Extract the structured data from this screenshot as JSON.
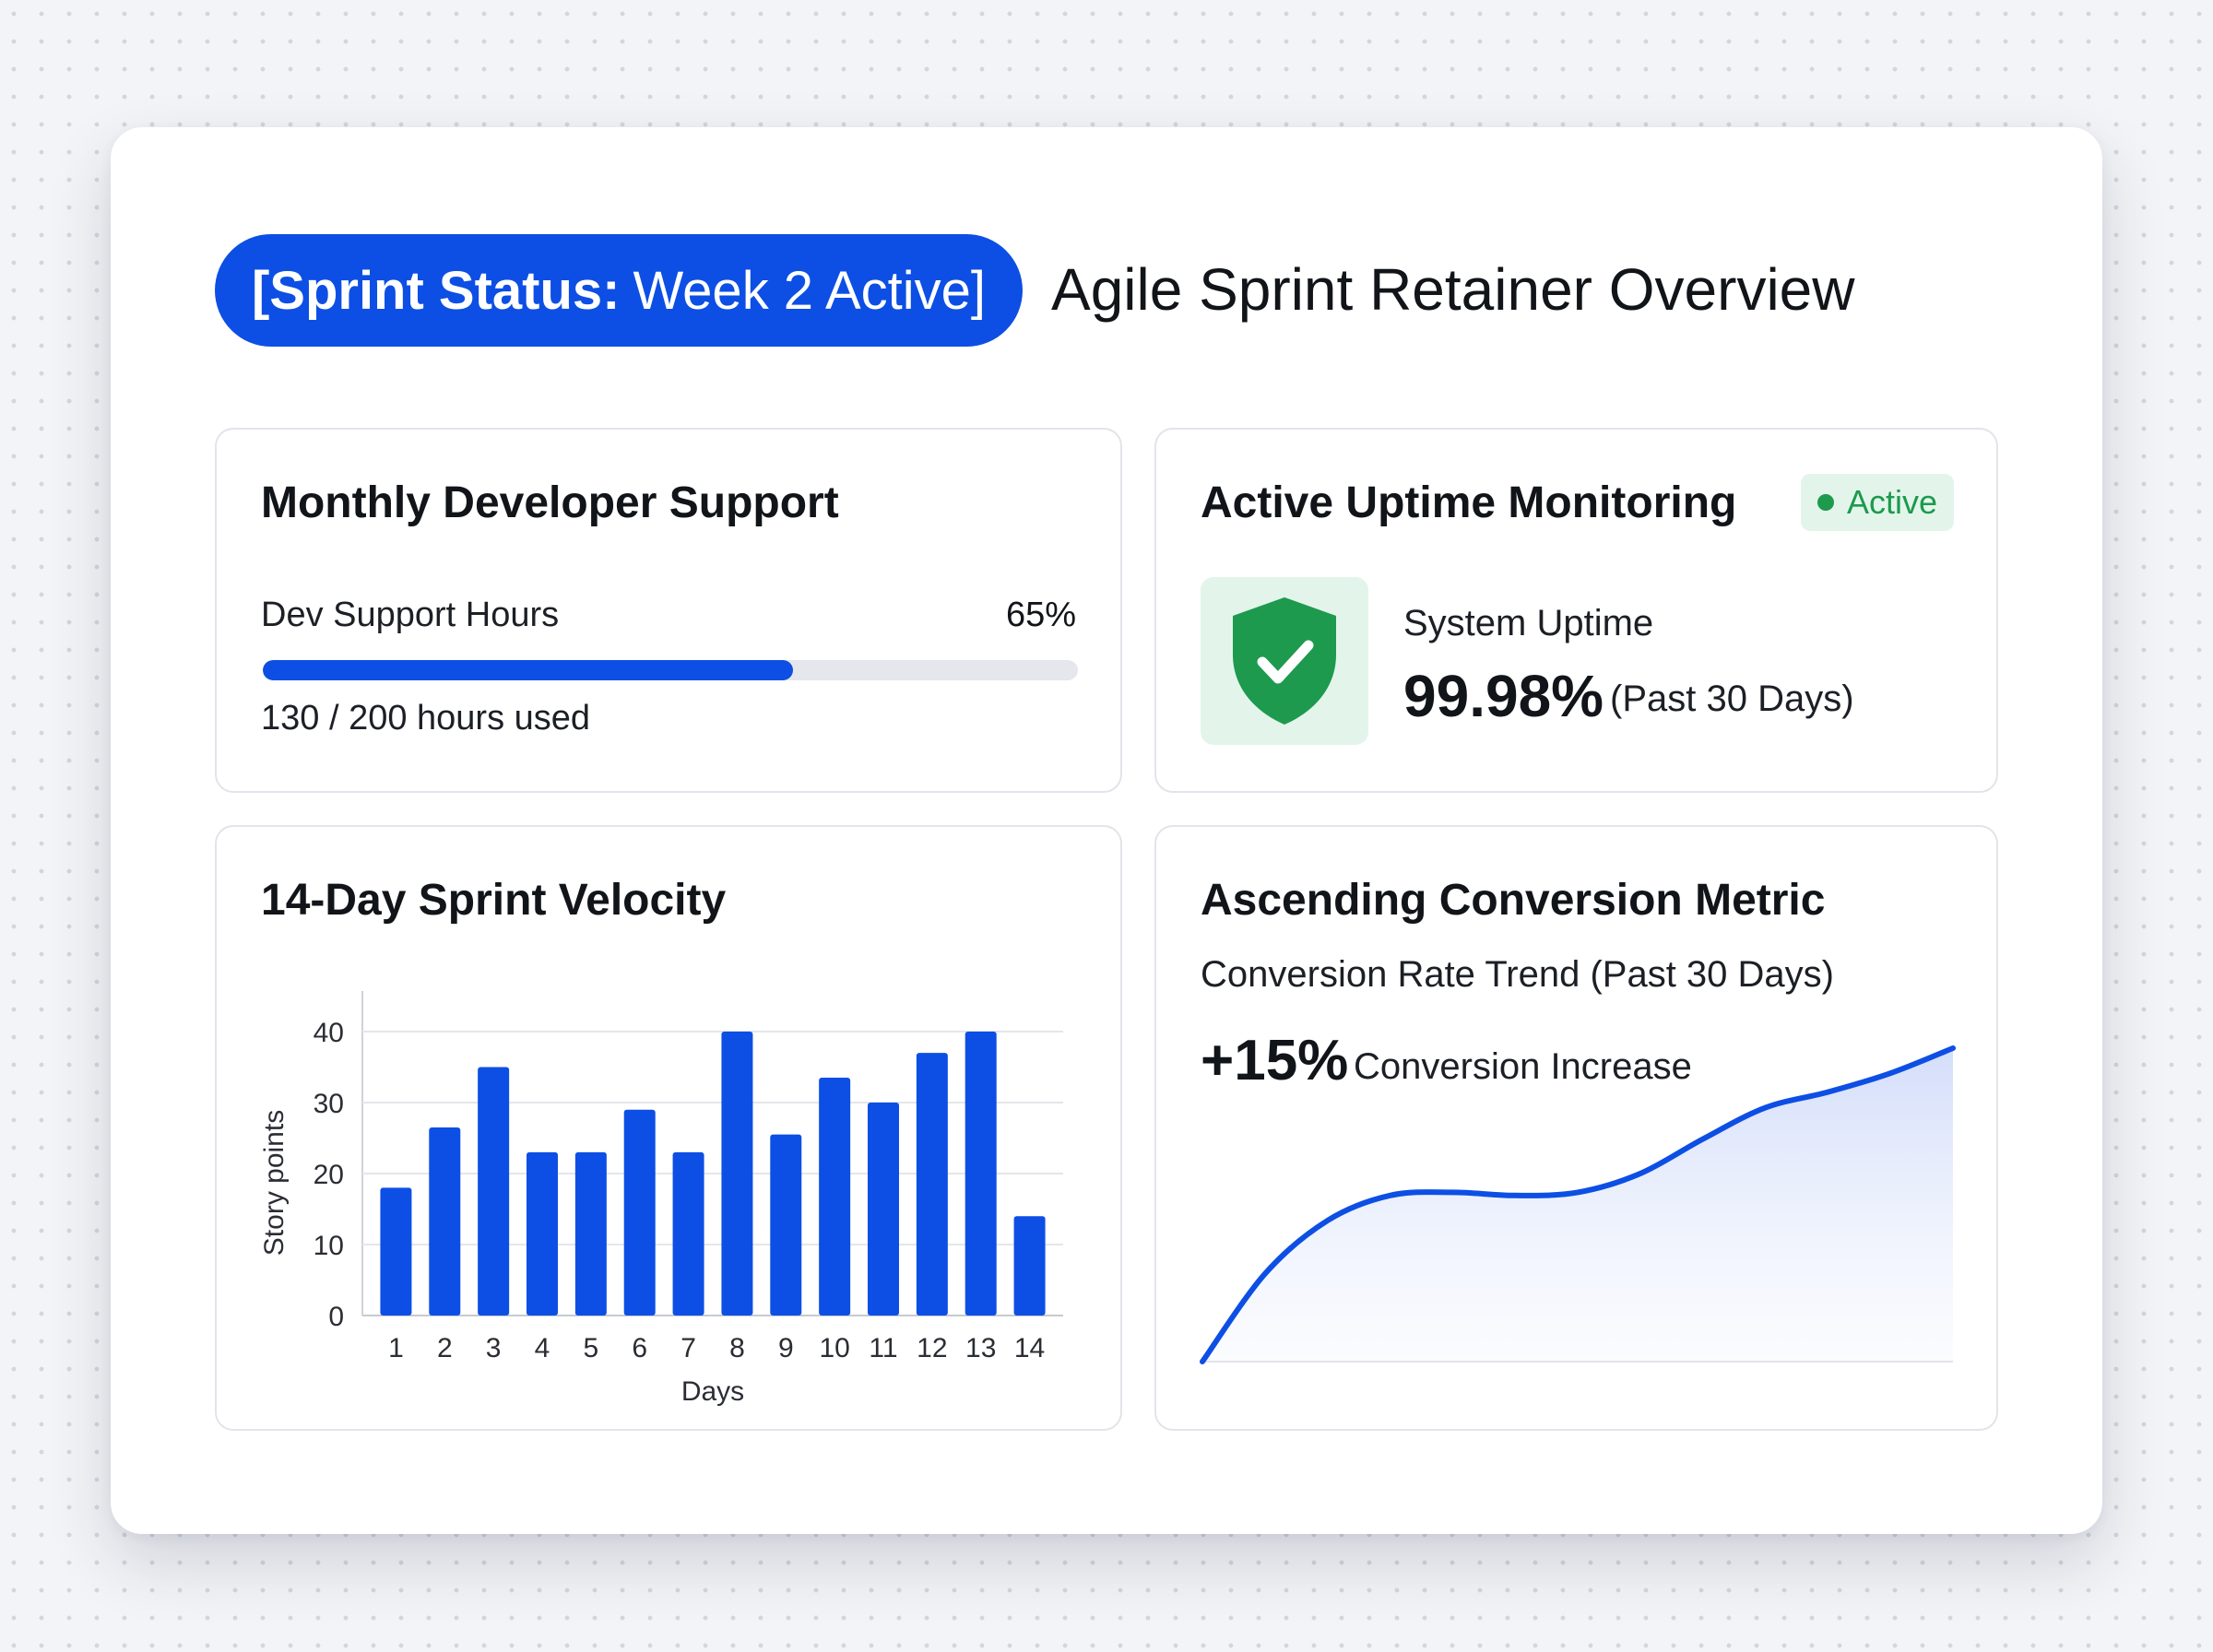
{
  "header": {
    "status_label": "[Sprint Status:",
    "status_value": "Week 2 Active]",
    "title": "Agile Sprint Retainer Overview",
    "accent_color": "#0d4fe4"
  },
  "support": {
    "title": "Monthly Developer Support",
    "metric_label": "Dev Support Hours",
    "percent_text": "65%",
    "progress": 0.65,
    "usage_text": "130 / 200 hours used"
  },
  "uptime": {
    "title": "Active Uptime Monitoring",
    "badge": "Active",
    "badge_color": "#1d9a4e",
    "icon": "shield-check-icon",
    "label": "System Uptime",
    "value": "99.98%",
    "period": "(Past 30 Days)"
  },
  "velocity": {
    "title": "14-Day Sprint Velocity"
  },
  "conversion": {
    "title": "Ascending Conversion Metric",
    "subtitle": "Conversion Rate Trend (Past 30 Days)",
    "delta": "+15%",
    "delta_label": "Conversion Increase"
  },
  "chart_data": [
    {
      "type": "bar",
      "categories": [
        "1",
        "2",
        "3",
        "4",
        "5",
        "6",
        "7",
        "8",
        "9",
        "10",
        "11",
        "12",
        "13",
        "14"
      ],
      "values": [
        18,
        26.5,
        35,
        23,
        23,
        29,
        23,
        40,
        25.5,
        33.5,
        30,
        37,
        40,
        14
      ],
      "xlabel": "Days",
      "ylabel": "Story points",
      "ylim": [
        0,
        40
      ],
      "yticks": [
        0,
        10,
        20,
        30,
        40
      ],
      "grid": true,
      "color": "#0d4fe4"
    },
    {
      "type": "area",
      "x": [
        0,
        1,
        2,
        3,
        4,
        5,
        6,
        7,
        8,
        9,
        10,
        11,
        12
      ],
      "values": [
        0,
        28,
        45,
        53,
        54,
        53,
        54,
        60,
        71,
        81,
        86,
        92,
        100
      ],
      "ylim": [
        0,
        100
      ],
      "color": "#0d4fe4"
    }
  ]
}
